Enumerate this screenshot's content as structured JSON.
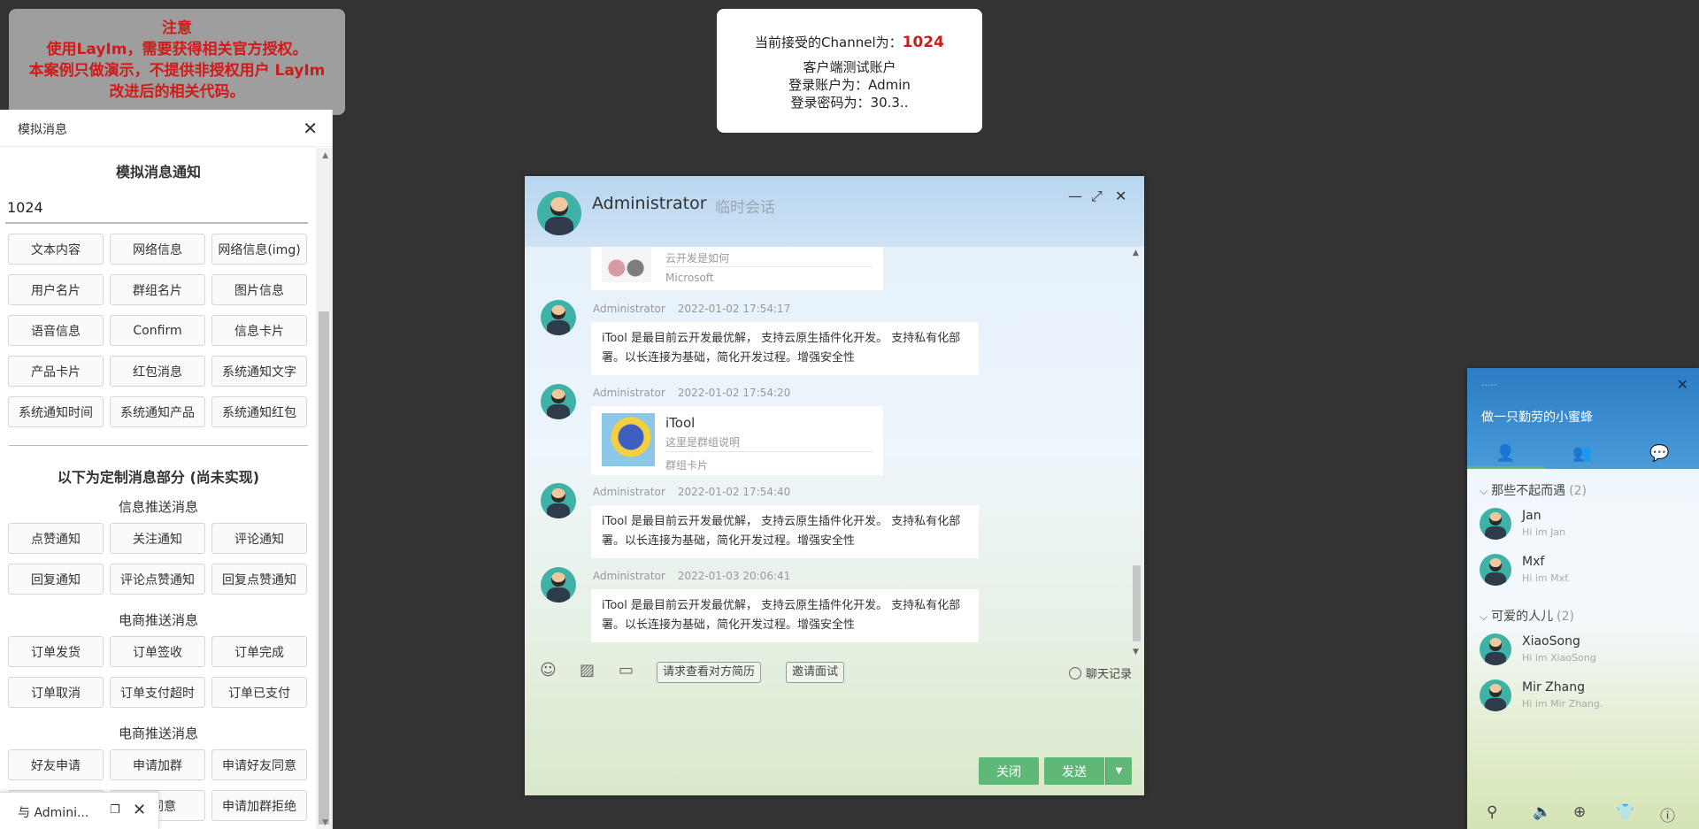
{
  "notice": {
    "line1": "注意",
    "line2": "使用LayIm，需要获得相关官方授权。",
    "line3": "本案例只做演示，不提供非授权用户 LayIm",
    "line4": "改进后的相关代码。"
  },
  "channel": {
    "prefix": "当前接受的Channel为：",
    "value": "1024",
    "test_account": "客户端测试账户",
    "login_account": "登录账户为：Admin",
    "login_password": "登录密码为：30.3.."
  },
  "sim_panel": {
    "header": "模拟消息",
    "title": "模拟消息通知",
    "channel_input": "1024",
    "buttons": [
      "文本内容",
      "网络信息",
      "网络信息(img)",
      "用户名片",
      "群组名片",
      "图片信息",
      "语音信息",
      "Confirm",
      "信息卡片",
      "产品卡片",
      "红包消息",
      "系统通知文字",
      "系统通知时间",
      "系统通知产品",
      "系统通知红包"
    ],
    "custom_title": "以下为定制消息部分 (尚未实现)",
    "section1_title": "信息推送消息",
    "section1_buttons": [
      "点赞通知",
      "关注通知",
      "评论通知",
      "回复通知",
      "评论点赞通知",
      "回复点赞通知"
    ],
    "section2_title": "电商推送消息",
    "section2_buttons": [
      "订单发货",
      "订单签收",
      "订单完成",
      "订单取消",
      "订单支付超时",
      "订单已支付"
    ],
    "section3_title": "电商推送消息",
    "section3_buttons": [
      "好友申请",
      "申请加群",
      "申请好友同意",
      "",
      "群同意",
      "申请加群拒绝"
    ]
  },
  "min_tab": {
    "label": "与 Admini..."
  },
  "chat": {
    "name": "Administrator",
    "tag": "临时会话",
    "top_card": {
      "desc": "云开发是如何",
      "source": "Microsoft"
    },
    "messages": [
      {
        "sender": "Administrator",
        "time": "2022-01-02 17:54:17",
        "text": "iTool 是最目前云开发最优解， 支持云原生插件化开发。 支持私有化部署。以长连接为基础，简化开发过程。增强安全性"
      },
      {
        "sender": "Administrator",
        "time": "2022-01-02 17:54:20",
        "card_title": "iTool",
        "card_desc": "这里是群组说明",
        "card_type": "群组卡片"
      },
      {
        "sender": "Administrator",
        "time": "2022-01-02 17:54:40",
        "text": "iTool 是最目前云开发最优解， 支持云原生插件化开发。 支持私有化部署。以长连接为基础，简化开发过程。增强安全性"
      },
      {
        "sender": "Administrator",
        "time": "2022-01-03 20:06:41",
        "text": "iTool 是最目前云开发最优解， 支持云原生插件化开发。 支持私有化部署。以长连接为基础，简化开发过程。增强安全性"
      }
    ],
    "toolbar": {
      "resume_btn": "请求查看对方简历",
      "interview_btn": "邀请面试",
      "history": "聊天记录"
    },
    "close_label": "关闭",
    "send_label": "发送"
  },
  "friend_panel": {
    "signature": "做一只勤劳的小蜜蜂",
    "groups": [
      {
        "name": "那些不起而遇",
        "count": "(2)",
        "friends": [
          {
            "name": "Jan",
            "sign": "Hi im Jan"
          },
          {
            "name": "Mxf",
            "sign": "Hi im Mxf."
          }
        ]
      },
      {
        "name": "可爱的人儿",
        "count": "(2)",
        "friends": [
          {
            "name": "XiaoSong",
            "sign": "Hi im XiaoSong"
          },
          {
            "name": "Mir Zhang",
            "sign": "Hi im Mir Zhang."
          }
        ]
      }
    ]
  },
  "colors": {
    "accent": "#5fb878",
    "notice_text": "#d11a1a",
    "panel_head": "#2d7cc4"
  }
}
